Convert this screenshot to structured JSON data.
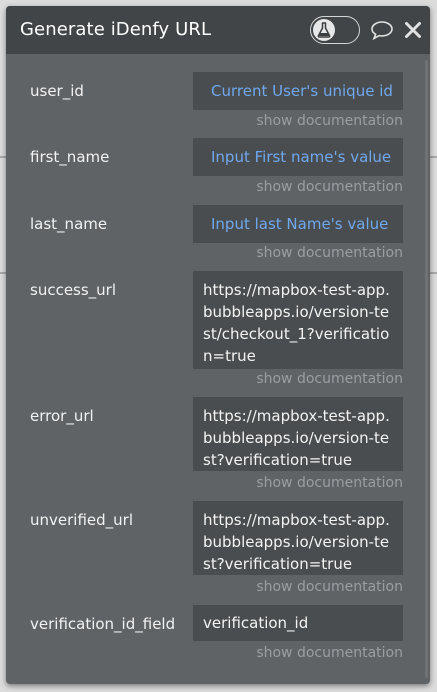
{
  "header": {
    "title": "Generate iDenfy URL",
    "toggle_icon": "flask-icon",
    "comment_icon": "speech-bubble-icon",
    "close_icon": "close-icon"
  },
  "doc_link": "show documentation",
  "fields": {
    "user_id": {
      "label": "user_id",
      "value": "Current User's unique id"
    },
    "first_name": {
      "label": "first_name",
      "value": "Input First name's value"
    },
    "last_name": {
      "label": "last_name",
      "value": "Input last Name's value"
    },
    "success_url": {
      "label": "success_url",
      "value": "https://mapbox-test-app.bubbleapps.io/version-test/checkout_1?verification=true"
    },
    "error_url": {
      "label": "error_url",
      "value": "https://mapbox-test-app.bubbleapps.io/version-test?verification=true"
    },
    "unverified_url": {
      "label": "unverified_url",
      "value": "https://mapbox-test-app.bubbleapps.io/version-test?verification=true"
    },
    "verification_id_field": {
      "label": "verification_id_field",
      "value": "verification_id"
    }
  },
  "colors": {
    "dynamic_value": "#6fa8ee",
    "panel": "#5f6366",
    "header": "#414547"
  }
}
